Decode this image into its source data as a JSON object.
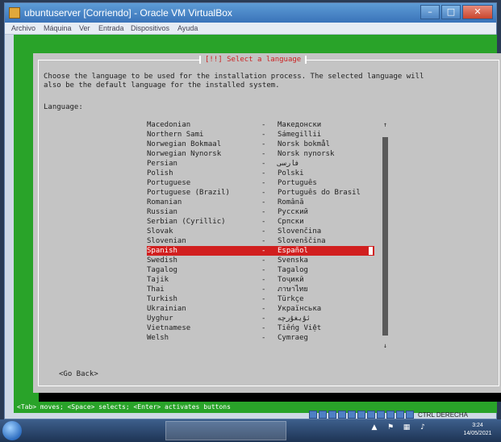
{
  "window": {
    "title": "ubuntuserver [Corriendo] - Oracle VM VirtualBox",
    "menu": [
      "Archivo",
      "Máquina",
      "Ver",
      "Entrada",
      "Dispositivos",
      "Ayuda"
    ],
    "minimize": "–",
    "maximize": "□",
    "close": "✕"
  },
  "installer": {
    "title": "[!!] Select a language",
    "instruction": "Choose the language to be used for the installation process. The selected language will\nalso be the default language for the installed system.",
    "language_label": "Language:",
    "languages": [
      {
        "en": "Macedonian",
        "native": "Македонски"
      },
      {
        "en": "Northern Sami",
        "native": "Sámegillii"
      },
      {
        "en": "Norwegian Bokmaal",
        "native": "Norsk bokmål"
      },
      {
        "en": "Norwegian Nynorsk",
        "native": "Norsk nynorsk"
      },
      {
        "en": "Persian",
        "native": "فارسی"
      },
      {
        "en": "Polish",
        "native": "Polski"
      },
      {
        "en": "Portuguese",
        "native": "Português"
      },
      {
        "en": "Portuguese (Brazil)",
        "native": "Português do Brasil"
      },
      {
        "en": "Romanian",
        "native": "Română"
      },
      {
        "en": "Russian",
        "native": "Русский"
      },
      {
        "en": "Serbian (Cyrillic)",
        "native": "Српски"
      },
      {
        "en": "Slovak",
        "native": "Slovenčina"
      },
      {
        "en": "Slovenian",
        "native": "Slovenščina"
      },
      {
        "en": "Spanish",
        "native": "Español"
      },
      {
        "en": "Swedish",
        "native": "Svenska"
      },
      {
        "en": "Tagalog",
        "native": "Tagalog"
      },
      {
        "en": "Tajik",
        "native": "Тоҷикӣ"
      },
      {
        "en": "Thai",
        "native": "ภาษาไทย"
      },
      {
        "en": "Turkish",
        "native": "Türkçe"
      },
      {
        "en": "Ukrainian",
        "native": "Українська"
      },
      {
        "en": "Uyghur",
        "native": "ئۇيغۇرچە"
      },
      {
        "en": "Vietnamese",
        "native": "Tiếng Việt"
      },
      {
        "en": "Welsh",
        "native": "Cymraeg"
      }
    ],
    "selected_language": "Spanish",
    "scroll_up": "↑",
    "scroll_down": "↓",
    "go_back": "<Go Back>",
    "help_text": "<Tab> moves; <Space> selects; <Enter> activates buttons"
  },
  "statusbar": {
    "host_key": "CTRL DERECHA"
  },
  "taskbar": {
    "time": "3:24",
    "date": "14/05/2021"
  }
}
